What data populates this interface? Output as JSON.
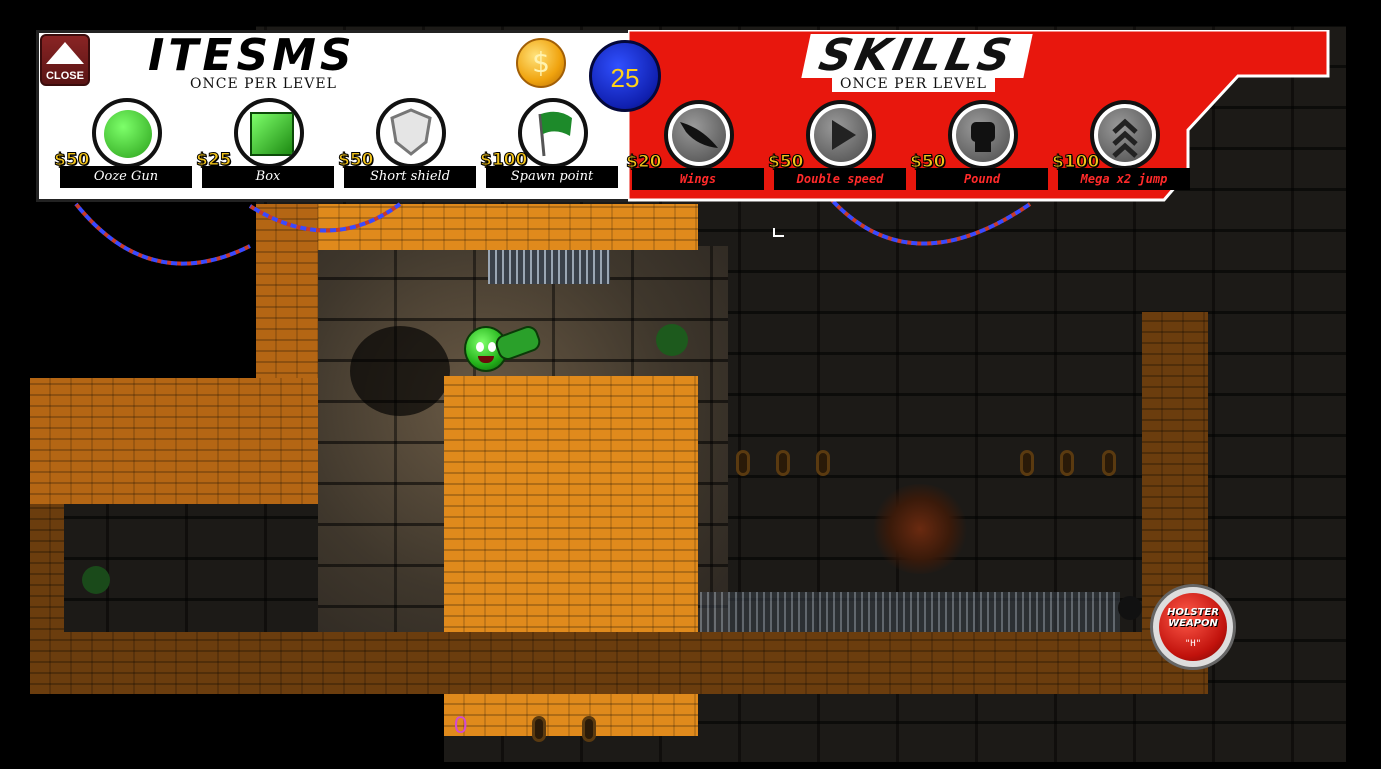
{
  "shop": {
    "close_label": "CLOSE",
    "items_title": "ITESMS",
    "items_subtitle": "ONCE PER LEVEL",
    "skills_title": "SKILLS",
    "skills_subtitle": "ONCE PER LEVEL",
    "coins": "25",
    "items": [
      {
        "price": "$50",
        "label": "Ooze Gun",
        "icon": "ooze-gun-icon"
      },
      {
        "price": "$25",
        "label": "Box",
        "icon": "box-icon"
      },
      {
        "price": "$50",
        "label": "Short shield",
        "icon": "shield-icon"
      },
      {
        "price": "$100",
        "label": "Spawn point",
        "icon": "flag-icon"
      }
    ],
    "skills": [
      {
        "price": "$20",
        "label": "Wings",
        "icon": "wing-icon"
      },
      {
        "price": "$50",
        "label": "Double speed",
        "icon": "play-arrow-icon"
      },
      {
        "price": "$50",
        "label": "Pound",
        "icon": "fist-icon"
      },
      {
        "price": "$100",
        "label": "Mega x2 jump",
        "icon": "double-chevron-up-icon"
      }
    ]
  },
  "hud": {
    "holster_label": "HOLSTER WEAPON",
    "holster_key": "\"H\"",
    "bottom_counter": "0"
  },
  "colors": {
    "skills_panel": "#e8170d",
    "items_panel": "#ffffff",
    "coin_badge": "#1428c8",
    "price_text": "#f2c31a",
    "skill_label_text": "#ff2a2a",
    "brick_orange": "#e08a1c"
  }
}
